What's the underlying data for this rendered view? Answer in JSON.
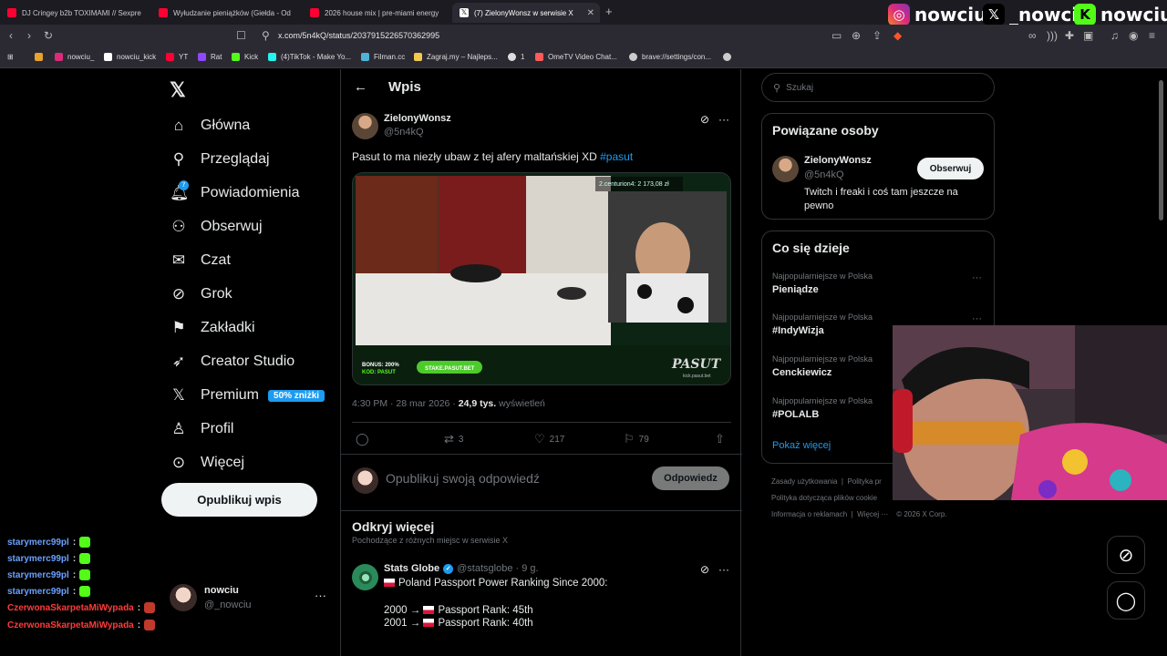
{
  "browser": {
    "tabs": [
      {
        "label": "DJ Cringey b2b TOXIMAMI // Sexpre",
        "color": "#ff0033"
      },
      {
        "label": "Wyłudzanie pieniążków (Giełda - Od",
        "color": "#ff0033"
      },
      {
        "label": "2026 house mix | pre-miami energy",
        "color": "#ff0033"
      },
      {
        "label": "(7) ZielonyWonsz w serwisie X",
        "color": "#ffffff"
      }
    ],
    "url": "x.com/5n4kQ/status/2037915226570362995",
    "bookmarks": [
      "nowciu_",
      "nowciu_kick",
      "YT",
      "Rat",
      "Kick",
      "(4)TikTok - Make Yo...",
      "Filman.cc",
      "Zagraj.my – Najleps...",
      "1",
      "OmeTV Video Chat...",
      "brave://settings/con..."
    ]
  },
  "stream_overlay": {
    "instagram": "nowciu_",
    "x": "_nowciu",
    "kick": "nowciu"
  },
  "sidebar": {
    "nav": [
      {
        "label": "Główna",
        "icon": "home-icon"
      },
      {
        "label": "Przeglądaj",
        "icon": "search-icon"
      },
      {
        "label": "Powiadomienia",
        "icon": "bell-icon"
      },
      {
        "label": "Obserwuj",
        "icon": "follow-icon"
      },
      {
        "label": "Czat",
        "icon": "mail-icon"
      },
      {
        "label": "Grok",
        "icon": "grok-icon"
      },
      {
        "label": "Zakładki",
        "icon": "bookmark-icon"
      },
      {
        "label": "Creator Studio",
        "icon": "rocket-icon"
      },
      {
        "label": "Premium",
        "icon": "x-icon"
      },
      {
        "label": "Profil",
        "icon": "person-icon"
      },
      {
        "label": "Więcej",
        "icon": "more-circle-icon"
      }
    ],
    "notif_count": "7",
    "premium_badge": "50% zniżki",
    "post_button": "Opublikuj wpis",
    "account": {
      "name": "nowciu",
      "handle": "@_nowciu"
    }
  },
  "chat": [
    {
      "user": "starymerc99pl",
      "color": "#6aa1ff"
    },
    {
      "user": "starymerc99pl",
      "color": "#6aa1ff"
    },
    {
      "user": "starymerc99pl",
      "color": "#6aa1ff"
    },
    {
      "user": "starymerc99pl",
      "color": "#6aa1ff"
    },
    {
      "user": "CzerwonaSkarpetaMiWypada",
      "color": "#ff3b3b"
    },
    {
      "user": "CzerwonaSkarpetaMiWypada",
      "color": "#ff3b3b"
    }
  ],
  "main": {
    "header": "Wpis",
    "post": {
      "author": "ZielonyWonsz",
      "handle": "@5n4kQ",
      "text": "Pasut to ma niezły ubaw z tej afery maltańskiej XD ",
      "hashtag": "#pasut",
      "time": "4:30 PM · 28 mar 2026 · ",
      "views_count": "24,9 tys.",
      "views_label": " wyświetleń",
      "retweets": "3",
      "likes": "217",
      "bookmarks": "79",
      "media": {
        "overlay_rank1": "2.centurion4: 2 173,08 zł",
        "bonus": "BONUS: 200%",
        "code": "KOD: PASUT",
        "cta": "STAKE.PASUT.BET",
        "logo": "PASUT",
        "logo_sub": "kick.pasut.bet"
      }
    },
    "reply_placeholder": "Opublikuj swoją odpowiedź",
    "reply_button": "Odpowiedz",
    "discover_title": "Odkryj więcej",
    "discover_sub": "Pochodzące z różnych miejsc w serwisie X",
    "suggested": {
      "name": "Stats Globe",
      "handle": "@statsglobe · 9 g.",
      "line1": "Poland Passport Power Ranking Since 2000:",
      "line2": "2000 → ",
      "line2b": "Passport Rank: 45th",
      "line3": "2001 → ",
      "line3b": "Passport Rank: 40th"
    }
  },
  "right": {
    "search_placeholder": "Szukaj",
    "related_title": "Powiązane osoby",
    "related": {
      "name": "ZielonyWonsz",
      "handle": "@5n4kQ",
      "bio": "Twitch i freaki i coś tam jeszcze na pewno",
      "follow": "Obserwuj"
    },
    "trending_title": "Co się dzieje",
    "trends": [
      {
        "context": "Najpopularniejsze w Polska",
        "name": "Pieniądze"
      },
      {
        "context": "Najpopularniejsze w Polska",
        "name": "#IndyWizja"
      },
      {
        "context": "Najpopularniejsze w Polska",
        "name": "Cenckiewicz"
      },
      {
        "context": "Najpopularniejsze w Polska",
        "name": "#POLALB"
      }
    ],
    "show_more": "Pokaż więcej",
    "footer": {
      "l1a": "Zasady użytkowania",
      "l1b": "Polityka pr",
      "l2": "Polityka dotycząca plików cookie",
      "l3a": "Informacja o reklamach",
      "l3b": "Więcej ···",
      "l3c": "© 2026 X Corp."
    }
  }
}
